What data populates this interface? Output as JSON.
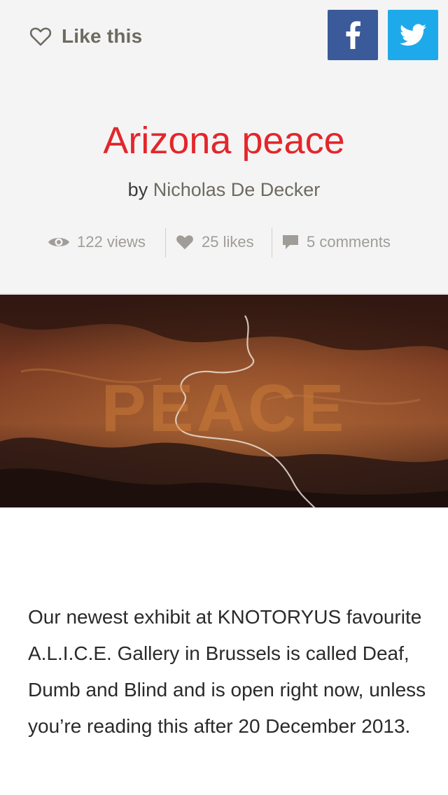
{
  "header": {
    "like_label": "Like this",
    "share": {
      "facebook_icon": "facebook-f-icon",
      "twitter_icon": "twitter-bird-icon",
      "facebook_color": "#3b5a99",
      "twitter_color": "#1eaaea"
    }
  },
  "post": {
    "title": "Arizona peace",
    "by_prefix": "by",
    "author": "Nicholas De Decker",
    "stats": {
      "views": "122 views",
      "likes": "25 likes",
      "comments": "5 comments"
    }
  },
  "hero": {
    "image_text": "PEACE",
    "description": "aerial desert canyon landscape with river"
  },
  "article": {
    "text": "Our newest exhibit at KNOTORYUS favourite A.L.I.C.E. Gallery in Brussels is called Deaf, Dumb and Blind and is open right now, unless you’re reading this after 20 December 2013."
  },
  "colors": {
    "title": "#e3262b",
    "muted": "#6d6a60",
    "stat": "#a09d98"
  }
}
